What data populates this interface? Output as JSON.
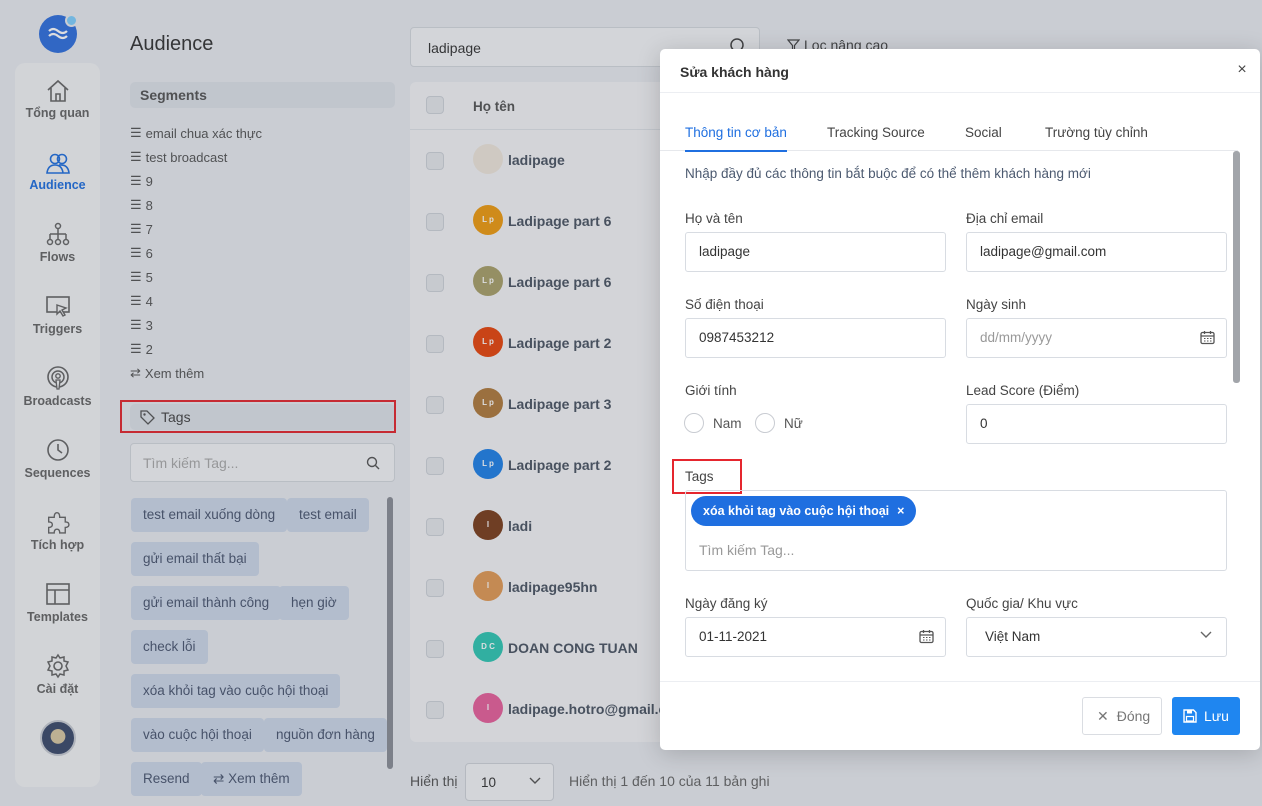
{
  "sidebar": {
    "items": [
      {
        "label": "Tổng quan",
        "icon": "home-icon"
      },
      {
        "label": "Audience",
        "icon": "users-icon"
      },
      {
        "label": "Flows",
        "icon": "flow-icon"
      },
      {
        "label": "Triggers",
        "icon": "trigger-icon"
      },
      {
        "label": "Broadcasts",
        "icon": "broadcast-icon"
      },
      {
        "label": "Sequences",
        "icon": "clock-icon"
      },
      {
        "label": "Tích hợp",
        "icon": "puzzle-icon"
      },
      {
        "label": "Templates",
        "icon": "template-icon"
      },
      {
        "label": "Cài đặt",
        "icon": "gear-icon"
      }
    ],
    "active": "Audience"
  },
  "audience": {
    "title": "Audience",
    "segments_header": "Segments",
    "segments": [
      "email chua xác thực",
      "test broadcast",
      "9",
      "8",
      "7",
      "6",
      "5",
      "4",
      "3",
      "2"
    ],
    "see_more": "Xem thêm",
    "tags_header": "Tags",
    "tag_search_placeholder": "Tìm kiếm Tag...",
    "tags": [
      "test email xuống dòng",
      "test email",
      "gửi email thất bại",
      "gửi email thành công",
      "hẹn giờ",
      "check lỗi",
      "xóa khỏi tag vào cuộc hội thoại",
      "vào cuộc hội thoại",
      "nguồn đơn hàng",
      "Resend"
    ],
    "tags_see_more": "Xem thêm"
  },
  "main": {
    "search_value": "ladipage",
    "advanced_filter": "Lọc nâng cao",
    "column_name": "Họ tên",
    "rows": [
      {
        "initials": "",
        "name": "ladipage",
        "color": "#efe7dc"
      },
      {
        "initials": "L p",
        "name": "Ladipage part 6",
        "color": "#ef9b0f"
      },
      {
        "initials": "L p",
        "name": "Ladipage part 6",
        "color": "#a9a06a"
      },
      {
        "initials": "L p",
        "name": "Ladipage part 2",
        "color": "#e8450c"
      },
      {
        "initials": "L p",
        "name": "Ladipage part 3",
        "color": "#b07a3c"
      },
      {
        "initials": "L p",
        "name": "Ladipage part 2",
        "color": "#1e80e8"
      },
      {
        "initials": "l",
        "name": "ladi",
        "color": "#7a3d1c"
      },
      {
        "initials": "l",
        "name": "ladipage95hn",
        "color": "#e29a55"
      },
      {
        "initials": "D C",
        "name": "DOAN CONG TUAN",
        "color": "#2fc7b4"
      },
      {
        "initials": "l",
        "name": "ladipage.hotro@gmail.co",
        "color": "#e8609c"
      }
    ],
    "footer": {
      "show_label": "Hiển thị",
      "page_size": "10",
      "info": "Hiển thị 1 đến 10 của 11 bản ghi"
    }
  },
  "modal": {
    "title": "Sửa khách hàng",
    "tabs": [
      "Thông tin cơ bản",
      "Tracking Source",
      "Social",
      "Trường tùy chỉnh"
    ],
    "active_tab": "Thông tin cơ bản",
    "hint": "Nhập đầy đủ các thông tin bắt buộc để có thể thêm khách hàng mới",
    "fields": {
      "name_label": "Họ và tên",
      "name_value": "ladipage",
      "email_label": "Địa chỉ email",
      "email_value": "ladipage@gmail.com",
      "phone_label": "Số điện thoại",
      "phone_value": "0987453212",
      "dob_label": "Ngày sinh",
      "dob_placeholder": "dd/mm/yyyy",
      "gender_label": "Giới tính",
      "gender_male": "Nam",
      "gender_female": "Nữ",
      "lead_label": "Lead Score (Điểm)",
      "lead_value": "0",
      "tags_label": "Tags",
      "tag_selected": "xóa khỏi tag vào cuộc hội thoại",
      "tag_search_placeholder": "Tìm kiếm Tag...",
      "reg_label": "Ngày đăng ký",
      "reg_value": "01-11-2021",
      "country_label": "Quốc gia/ Khu vực",
      "country_value": "Việt Nam"
    },
    "close_button": "Đóng",
    "save_button": "Lưu",
    "accent_color": "#1f6fe0",
    "highlight_color": "#e5262e"
  }
}
